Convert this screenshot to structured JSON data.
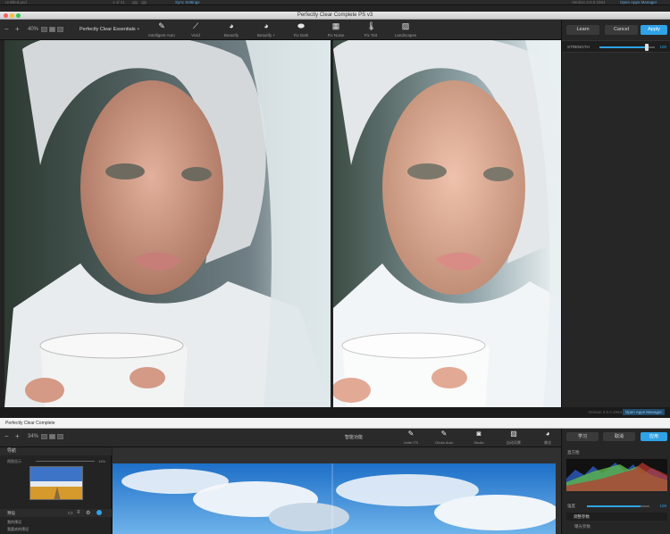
{
  "host": {
    "left_text": "Untitled.psd",
    "page_counter": "1 of 21",
    "sync_settings": "Sync Settings",
    "version": "Version 3.5.0.1564",
    "open_apps_manager": "Open Apps Manager"
  },
  "app": {
    "title": "Perfectly Clear Complete PS v3",
    "zoom": "40%",
    "preset": "Perfectly Clear Essentials",
    "tools": [
      {
        "label": "Intelligent Auto",
        "icon": "magic-wand-icon"
      },
      {
        "label": "Vivid",
        "icon": "brush-icon"
      },
      {
        "label": "Beautify",
        "icon": "face-icon"
      },
      {
        "label": "Beautify +",
        "icon": "face-plus-icon"
      },
      {
        "label": "Fix Dark",
        "icon": "eraser-icon"
      },
      {
        "label": "Fix Noise",
        "icon": "noise-icon"
      },
      {
        "label": "Fix Tint",
        "icon": "thermometer-icon"
      },
      {
        "label": "Landscapes",
        "icon": "landscape-icon"
      }
    ],
    "learn": "Learn",
    "cancel": "Cancel",
    "apply": "Apply",
    "strength_label": "STRENGTH",
    "strength_value": "100",
    "strength_fraction": 0.85,
    "version": "Version 3.5.0.1564",
    "open_apps_manager": "Open Apps Manager"
  },
  "bottom": {
    "title": "Perfectly Clear Complete",
    "zoom": "34%",
    "preset": "智能功能",
    "tools": [
      {
        "label": "Unite iTS",
        "icon": "magic-wand-icon"
      },
      {
        "label": "Ghoto Auto",
        "icon": "magic-wand-icon"
      },
      {
        "label": "Studio",
        "icon": "portrait-icon"
      },
      {
        "label": "自动风景",
        "icon": "landscape-icon"
      },
      {
        "label": "美化",
        "icon": "face-icon"
      }
    ],
    "learn": "学习",
    "cancel": "取消",
    "apply": "应用",
    "histogram_label": "直方图",
    "navigator_label": "导航",
    "zoom_fit": "视图显示",
    "zoom_pct": "13%",
    "presets_label": "预设",
    "preset_items": [
      "我的预设",
      "我喜欢的预设"
    ],
    "strength_label": "强度",
    "strength_value": "100",
    "adjust_label": "调整参数",
    "adjust_sub": "曝光参数"
  },
  "colors": {
    "accent": "#2fa3e6",
    "toolbar": "#2a2a2a",
    "panel": "#262626"
  }
}
